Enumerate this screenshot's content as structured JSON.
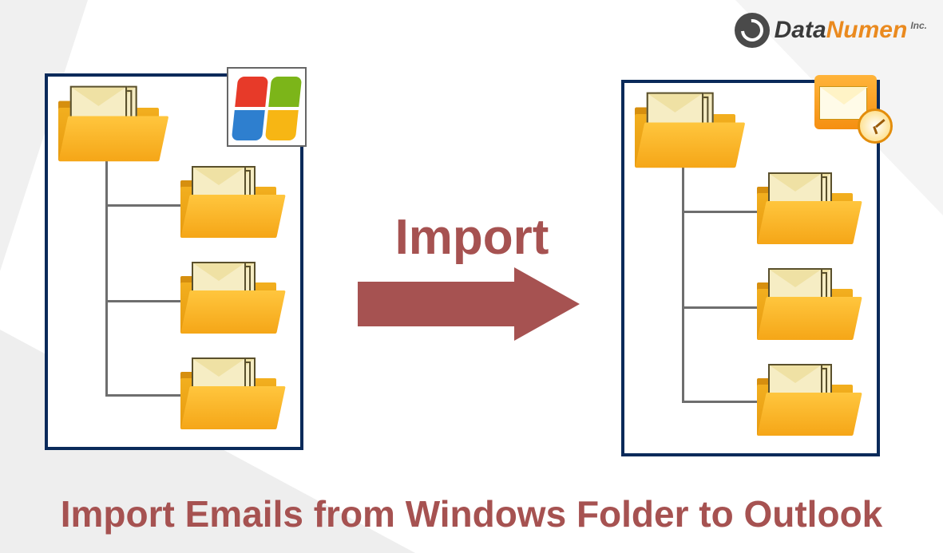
{
  "brand": {
    "name_part1": "Data",
    "name_part2": "Numen",
    "suffix": "Inc."
  },
  "arrow": {
    "label": "Import"
  },
  "caption": {
    "text": "Import Emails from Windows Folder to Outlook"
  },
  "badges": {
    "left": "Windows",
    "right": "Outlook"
  },
  "colors": {
    "accent": "#a65251",
    "border": "#0a2a5a",
    "folder": "#f5a617"
  }
}
